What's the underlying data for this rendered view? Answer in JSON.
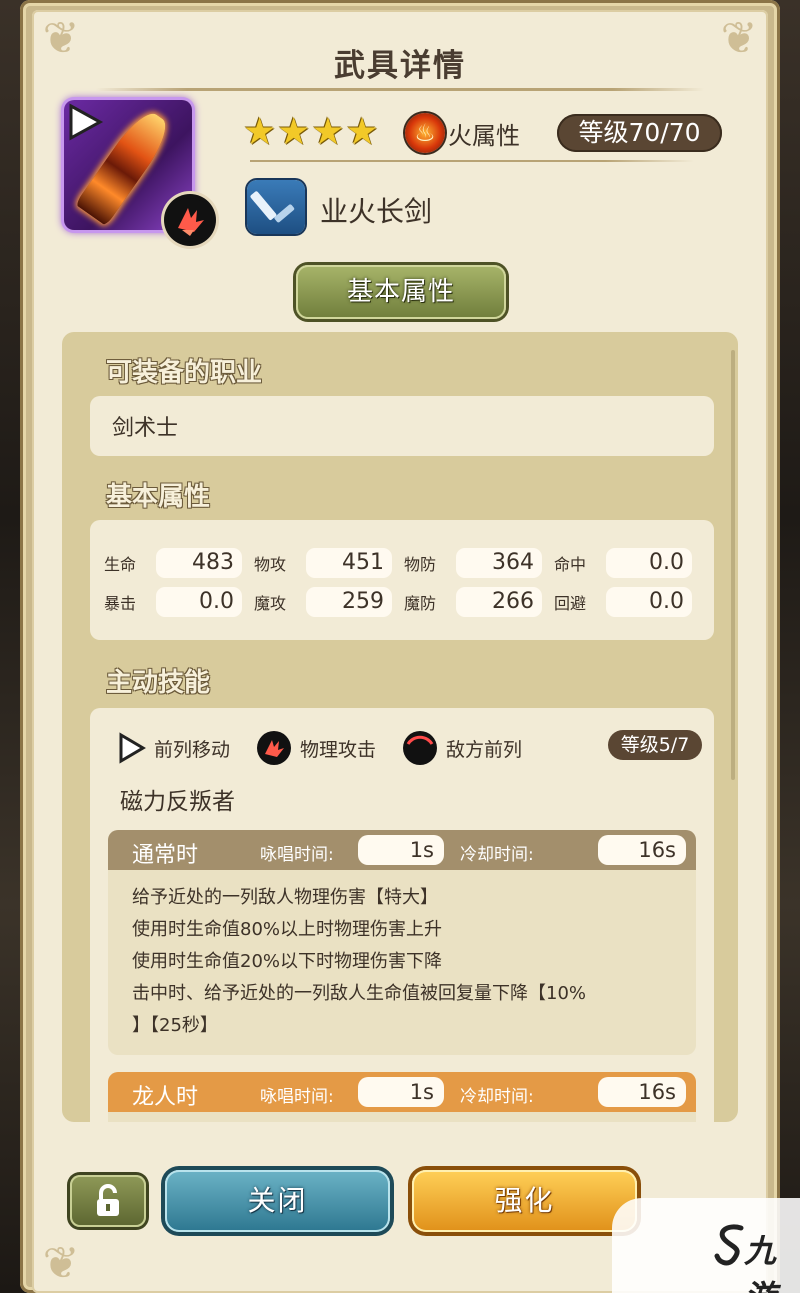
{
  "title": "武具详情",
  "weapon": {
    "name": "业火长剑",
    "stars": 4,
    "star_glyphs": [
      "★",
      "★",
      "★",
      "★"
    ],
    "element": "火属性",
    "level": "等级70/70"
  },
  "tab": {
    "label": "基本属性"
  },
  "jobs": {
    "title": "可装备的职业",
    "value": "剑术士"
  },
  "base_stats": {
    "title": "基本属性",
    "rows": [
      [
        {
          "label": "生命",
          "value": "483"
        },
        {
          "label": "物攻",
          "value": "451"
        },
        {
          "label": "物防",
          "value": "364"
        },
        {
          "label": "命中",
          "value": "0.0"
        }
      ],
      [
        {
          "label": "暴击",
          "value": "0.0"
        },
        {
          "label": "魔攻",
          "value": "259"
        },
        {
          "label": "魔防",
          "value": "266"
        },
        {
          "label": "回避",
          "value": "0.0"
        }
      ]
    ]
  },
  "skill": {
    "title": "主动技能",
    "move": "前列移动",
    "attack_type": "物理攻击",
    "target": "敌方前列",
    "level": "等级5/7",
    "name": "磁力反叛者",
    "normal": {
      "label": "通常时",
      "cast_label": "咏唱时间:",
      "cast_value": "1s",
      "cooldown_label": "冷却时间:",
      "cooldown_value": "16s",
      "lines": [
        "给予近处的一列敌人物理伤害【特大】",
        "使用时生命值80%以上时物理伤害上升",
        "使用时生命值20%以下时物理伤害下降",
        "击中时、给予近处的一列敌人生命值被回复量下降【10%",
        "】【25秒】"
      ]
    },
    "dragon": {
      "label": "龙人时",
      "cast_label": "咏唱时间:",
      "cast_value": "1s",
      "cooldown_label": "冷却时间:",
      "cooldown_value": "16s"
    }
  },
  "buttons": {
    "close": "关闭",
    "enhance": "强化"
  },
  "watermark": "九游",
  "colors": {
    "panel": "#f2ebd6",
    "content": "#d8cb9c",
    "level_pill": "#5a4633",
    "normal_phase": "#a38f6c",
    "dragon_phase": "#e49a46",
    "close_button": "#2d7790",
    "enhance_button": "#e0901a",
    "rarity_frame": "#6b2aa3"
  },
  "icons": [
    "play-icon",
    "physical-attack-icon",
    "fire-element-icon",
    "sword-type-icon",
    "enemy-front-row-icon",
    "lock-icon",
    "star-icon"
  ]
}
